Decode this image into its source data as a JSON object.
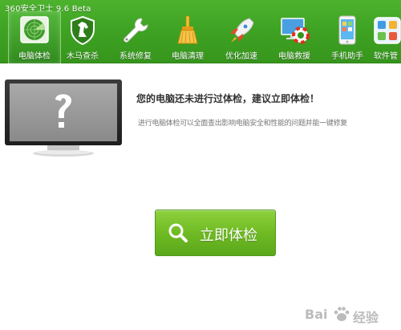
{
  "app": {
    "title": "360安全卫士 9.6 Beta"
  },
  "tabs": [
    {
      "label": "电脑体检",
      "icon": "radar-scan-icon",
      "active": true
    },
    {
      "label": "木马查杀",
      "icon": "horse-shield-icon",
      "active": false
    },
    {
      "label": "系统修复",
      "icon": "wrench-icon",
      "active": false
    },
    {
      "label": "电脑清理",
      "icon": "broom-icon",
      "active": false
    },
    {
      "label": "优化加速",
      "icon": "rocket-icon",
      "active": false
    },
    {
      "label": "电脑救援",
      "icon": "lifebuoy-monitor-icon",
      "active": false
    },
    {
      "label": "手机助手",
      "icon": "phone-icon",
      "active": false
    },
    {
      "label": "软件管",
      "icon": "software-grid-icon",
      "active": false
    }
  ],
  "main": {
    "monitor_icon": "question-mark-monitor-icon",
    "headline": "您的电脑还未进行过体检，建议立即体检！",
    "subtext": "进行电脑体检可以全面查出影响电脑安全和性能的问题并能一键修复",
    "check_button": {
      "label": "立即体检",
      "icon": "search-icon"
    }
  },
  "watermark": {
    "left": "Bai",
    "right": "经验"
  },
  "colors": {
    "header_green": "#3fa324",
    "button_green": "#72bd25",
    "headline": "#333333"
  }
}
